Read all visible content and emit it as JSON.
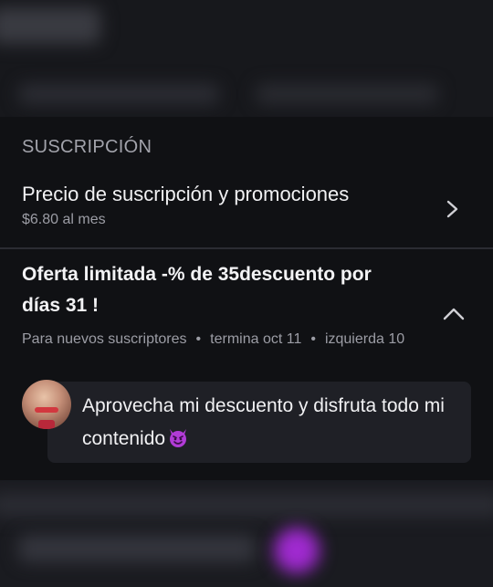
{
  "subscription": {
    "section_title": "SUSCRIPCIÓN",
    "price_row": {
      "title": "Precio de suscripción y promociones",
      "subtitle": "$6.80 al mes"
    },
    "offer": {
      "title": "Oferta limitada -% de 35descuento por días 31 !",
      "audience": "Para nuevos suscriptores",
      "ends": "termina oct 11",
      "remaining": "izquierda 10",
      "message": "Aprovecha mi descuento y disfruta todo mi contenido"
    }
  },
  "icons": {
    "price_chevron": "chevron-right-icon",
    "offer_chevron": "chevron-up-icon",
    "emoji": "smiling-devil-icon"
  },
  "colors": {
    "panel_bg": "#101114",
    "bubble_bg": "#1f2026",
    "muted_text": "#9c9da5",
    "devil_emoji": "#b13bd6"
  }
}
